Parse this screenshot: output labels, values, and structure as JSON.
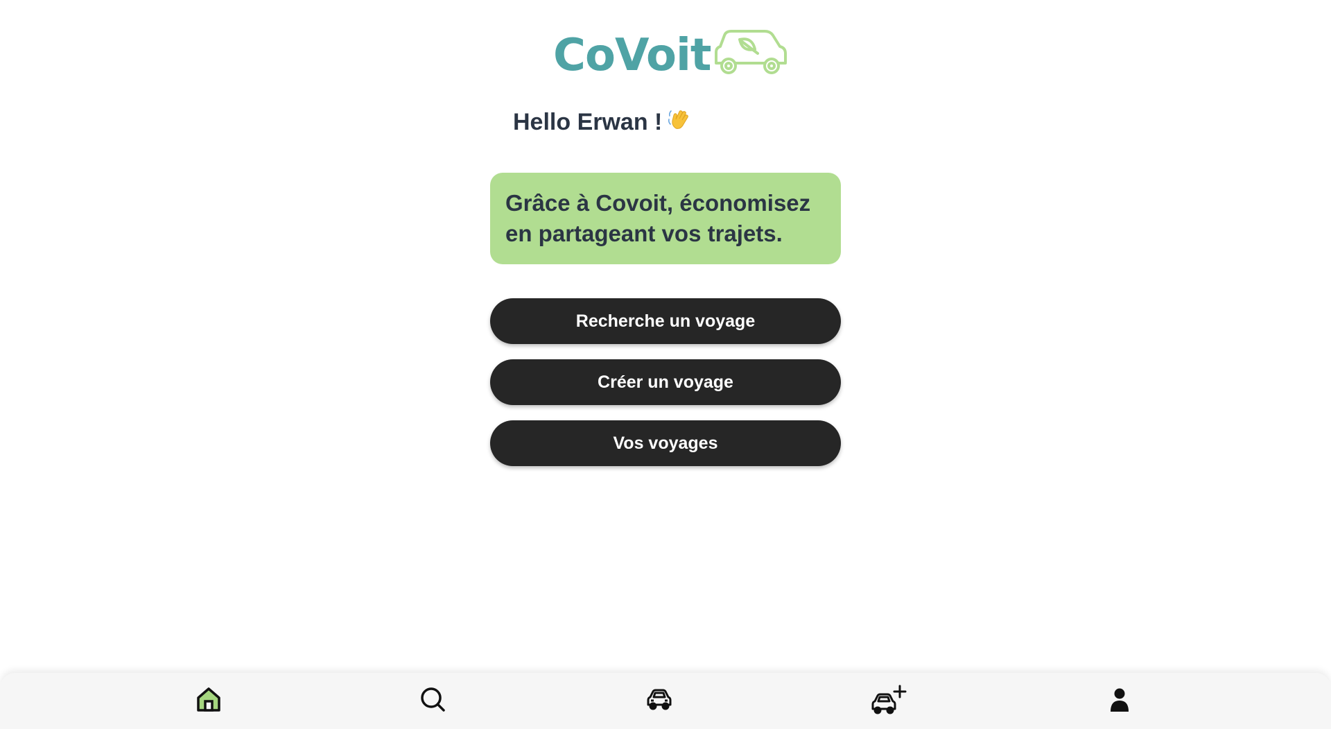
{
  "brand": {
    "name": "CoVoit",
    "logo_color": "#4fa3a5",
    "car_icon_color": "#b1dd91"
  },
  "greeting": {
    "text": "Hello Erwan !",
    "emoji_icon": "waving-hand-icon"
  },
  "promo": {
    "text": "Grâce à Covoit, économisez en partageant vos trajets.",
    "background": "#b1dd91"
  },
  "actions": {
    "search_label": "Recherche un voyage",
    "create_label": "Créer un voyage",
    "trips_label": "Vos voyages"
  },
  "bottom_nav": {
    "items": [
      {
        "icon": "home-icon",
        "active": true
      },
      {
        "icon": "search-icon",
        "active": false
      },
      {
        "icon": "car-icon",
        "active": false
      },
      {
        "icon": "add-car-icon",
        "active": false
      },
      {
        "icon": "user-icon",
        "active": false
      }
    ],
    "active_color": "#a5d67f"
  }
}
